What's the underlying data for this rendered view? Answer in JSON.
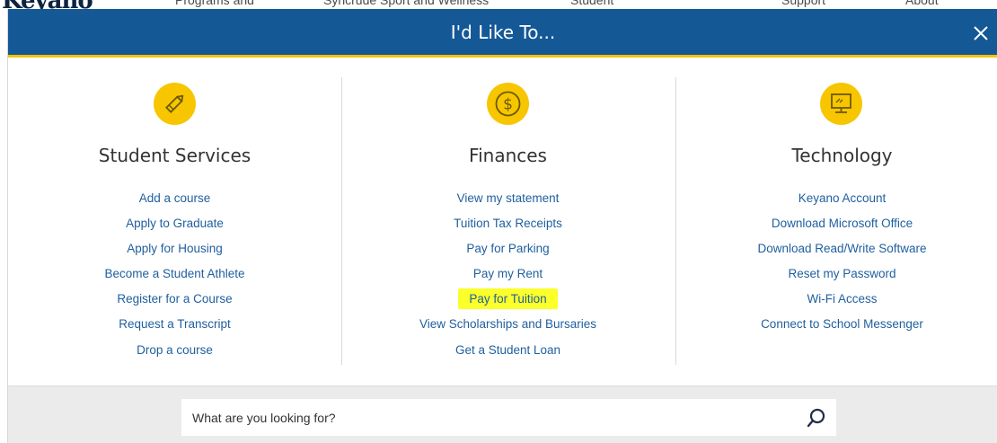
{
  "background_nav": {
    "logo": "Keyano",
    "items": [
      "Programs and",
      "Syncrude Sport and Wellness",
      "Student",
      "Support",
      "About"
    ]
  },
  "modal": {
    "title": "I'd Like To...",
    "close_icon": "close-icon",
    "colors": {
      "header": "#145896",
      "accent": "#f7c600",
      "link": "#1f5f9f",
      "highlight": "#fbff2a"
    },
    "columns": [
      {
        "title": "Student Services",
        "icon": "pencil-icon",
        "links": [
          "Add a course",
          "Apply to Graduate",
          "Apply for Housing",
          "Become a Student Athlete",
          "Register for a Course",
          "Request a Transcript",
          "Drop a course"
        ]
      },
      {
        "title": "Finances",
        "icon": "dollar-coin-icon",
        "links": [
          "View my statement",
          "Tuition Tax Receipts",
          "Pay for Parking",
          "Pay my Rent",
          "Pay for Tuition",
          "View Scholarships and Bursaries",
          "Get a Student Loan"
        ]
      },
      {
        "title": "Technology",
        "icon": "computer-monitor-icon",
        "links": [
          "Keyano Account",
          "Download Microsoft Office",
          "Download Read/Write Software",
          "Reset my Password",
          "Wi-Fi Access",
          "Connect to School Messenger"
        ]
      }
    ],
    "search": {
      "placeholder": "What are you looking for?",
      "icon": "search-icon"
    }
  }
}
